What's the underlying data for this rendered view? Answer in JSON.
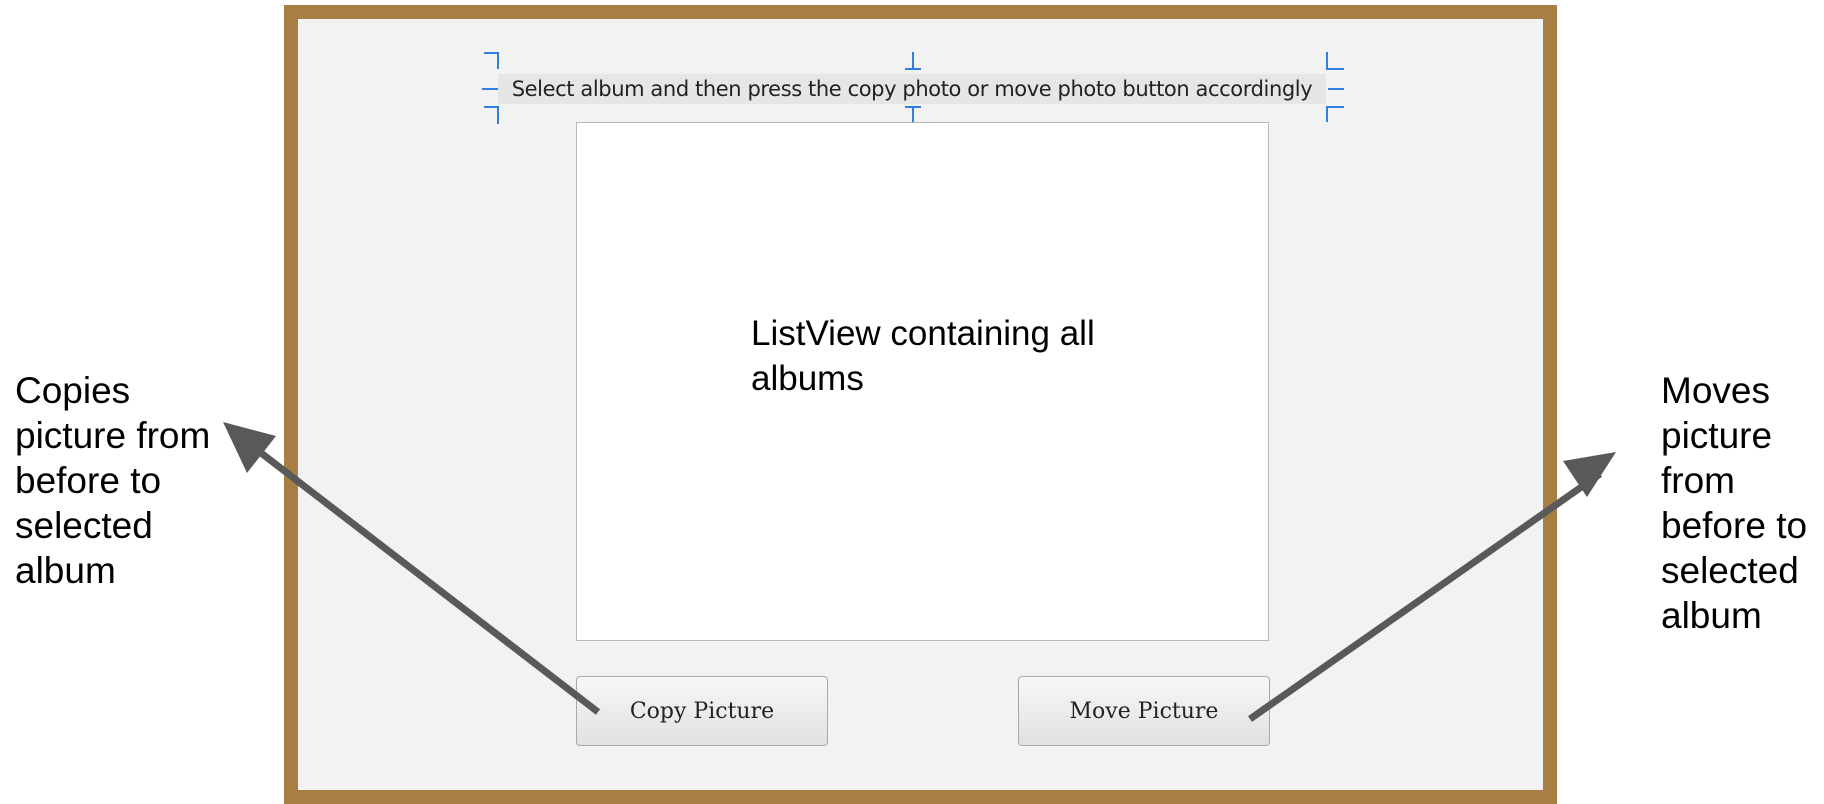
{
  "annotations": {
    "left_note": "Copies picture from before to selected album",
    "right_note": "Moves picture from before to selected album"
  },
  "dialog": {
    "instruction_label": "Select album and then press the copy photo or move photo button accordingly",
    "listview_placeholder": "ListView containing all albums",
    "copy_button_label": "Copy Picture",
    "move_button_label": "Move Picture"
  },
  "colors": {
    "frame_border": "#a77f44",
    "dialog_background": "#f2f2f2",
    "selection_handles": "#2f7fe0",
    "arrow": "#595959"
  }
}
